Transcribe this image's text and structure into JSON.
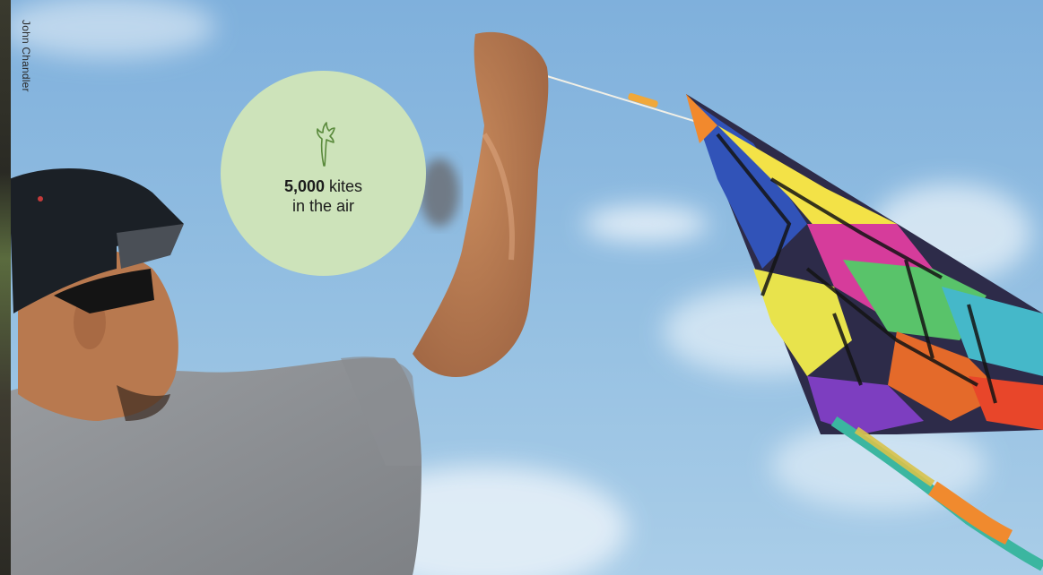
{
  "photo": {
    "subject": "kite-flyer-photo",
    "colors": {
      "sky": "#8db8dc",
      "shirt": "#8f9296",
      "cap": "#1c2126",
      "skin": "#b77a52",
      "circle": "#cde3ba",
      "leaf": "#5a8a3c"
    }
  },
  "credit": "John Chandler",
  "stat": {
    "number": "5,000",
    "unit": "kites",
    "line2": "in the air",
    "icon": "leaf-icon"
  }
}
